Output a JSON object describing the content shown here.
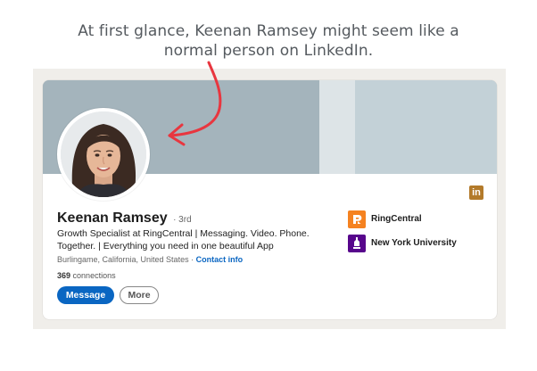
{
  "headline": {
    "line1": "At first glance, Keenan Ramsey might seem like a",
    "line2": "normal person on LinkedIn."
  },
  "profile": {
    "name": "Keenan Ramsey",
    "degree": "· 3rd",
    "bio": "Growth Specialist at RingCentral | Messaging. Video. Phone. Together. | Everything you need in one beautiful App",
    "location": "Burlingame, California, United States",
    "location_separator": "·",
    "contact_link": "Contact info",
    "connections_count": "369",
    "connections_label": "connections",
    "linkedin_badge": "in"
  },
  "actions": {
    "message_label": "Message",
    "more_label": "More"
  },
  "orgs": [
    {
      "name": "RingCentral",
      "icon": "ringcentral-logo",
      "color": "#f58220"
    },
    {
      "name": "New York University",
      "icon": "nyu-logo",
      "color": "#57068c"
    }
  ],
  "colors": {
    "primary": "#0a66c2",
    "annotation_arrow": "#e8363f",
    "banner": "#a4b4bc",
    "linkedin_badge": "#b37a2a"
  }
}
